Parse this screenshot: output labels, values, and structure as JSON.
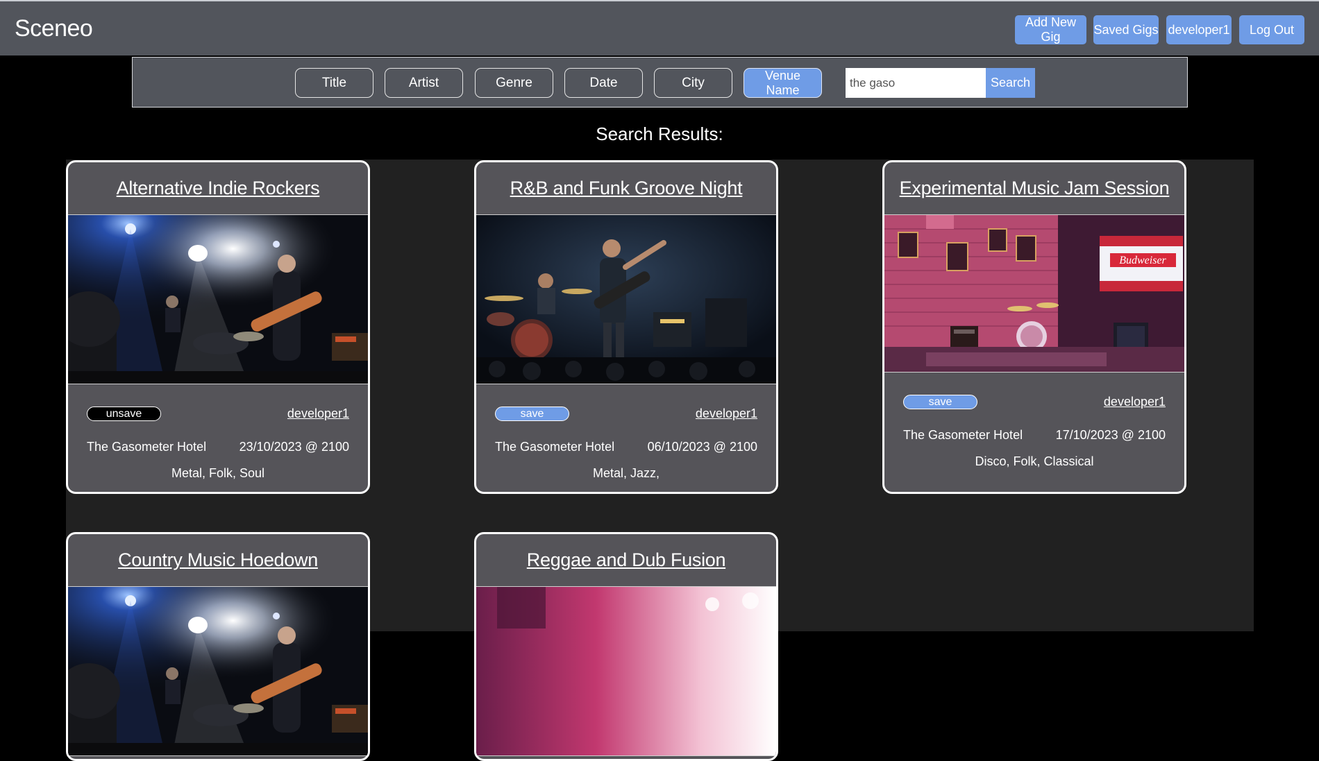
{
  "app": {
    "brand": "Sceneo"
  },
  "nav": {
    "add_gig": "Add New Gig",
    "saved_gigs": "Saved Gigs",
    "user": "developer1",
    "logout": "Log Out"
  },
  "filters": {
    "title": "Title",
    "artist": "Artist",
    "genre": "Genre",
    "date": "Date",
    "city": "City",
    "venue": "Venue Name",
    "active": "Venue Name"
  },
  "search": {
    "value": "the gaso",
    "button": "Search"
  },
  "results": {
    "heading": "Search Results:",
    "cards": [
      {
        "title": "Alternative Indie Rockers",
        "save_label": "unsave",
        "author": "developer1",
        "venue": "The Gasometer Hotel",
        "date": "23/10/2023 @ 2100",
        "genres": "Metal, Folk, Soul",
        "image": "concert-guitarist-blue-lights"
      },
      {
        "title": "R&B and Funk Groove Night",
        "save_label": "save",
        "author": "developer1",
        "venue": "The Gasometer Hotel",
        "date": "06/10/2023 @ 2100",
        "genres": "Metal, Jazz,",
        "image": "band-on-stage-drummer-singer"
      },
      {
        "title": "Experimental Music Jam Session",
        "save_label": "save",
        "author": "developer1",
        "venue": "The Gasometer Hotel",
        "date": "17/10/2023 @ 2100",
        "genres": "Disco, Folk, Classical",
        "image": "pub-stage-red-brick-budweiser-flag"
      },
      {
        "title": "Country Music Hoedown",
        "image": "concert-guitarist-blue-lights"
      },
      {
        "title": "Reggae and Dub Fusion",
        "image": "pink-stage-lights"
      }
    ]
  },
  "colors": {
    "navbar": "#52555c",
    "accent": "#6f9ce6",
    "card": "#555459",
    "results_bg": "#212121",
    "page_bg": "#000000"
  }
}
